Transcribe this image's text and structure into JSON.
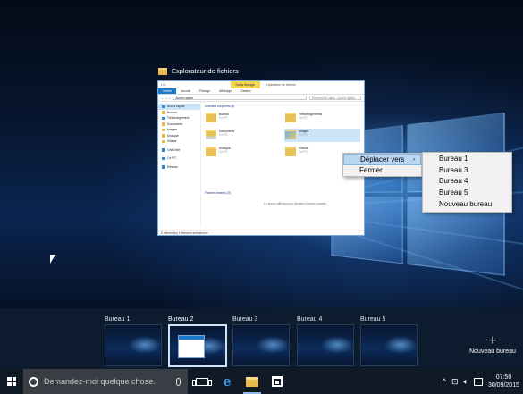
{
  "explorer": {
    "window_title": "Explorateur de fichiers",
    "context_tab": "Outils d'image",
    "title_text": "Explorateur de fichiers",
    "ribbon_tabs": [
      "Fichier",
      "Accueil",
      "Partage",
      "Affichage",
      "Gestion"
    ],
    "address": "Accès rapide",
    "search_placeholder": "Rechercher dans : Accès rapide",
    "nav_items": [
      "Accès rapide",
      "Bureau",
      "Téléchargement",
      "Documents",
      "Images",
      "Musique",
      "Vidéos",
      "OneDrive",
      "Ce PC",
      "Réseau"
    ],
    "frequent_header": "Dossiers fréquents (8)",
    "folders": [
      {
        "name": "Bureau",
        "sub": "Ce PC"
      },
      {
        "name": "Téléchargements",
        "sub": "Ce PC"
      },
      {
        "name": "Documents",
        "sub": "Ce PC"
      },
      {
        "name": "Images",
        "sub": "Ce PC"
      },
      {
        "name": "Musique",
        "sub": "Ce PC"
      },
      {
        "name": "Vidéos",
        "sub": "Ce PC"
      }
    ],
    "recent_header": "Fichiers récents (0)",
    "recent_note": "Le survol affichera les derniers fichiers ouverts",
    "status": "8 élément(s)   1 élément sélectionné"
  },
  "context_menu": {
    "items": [
      "Déplacer vers",
      "Fermer"
    ],
    "arrow": "›"
  },
  "submenu": {
    "items": [
      "Bureau 1",
      "Bureau 3",
      "Bureau 4",
      "Bureau 5",
      "Nouveau bureau"
    ]
  },
  "virtual_desktops": [
    {
      "name": "Bureau 1",
      "active": false
    },
    {
      "name": "Bureau 2",
      "active": true
    },
    {
      "name": "Bureau 3",
      "active": false
    },
    {
      "name": "Bureau 4",
      "active": false
    },
    {
      "name": "Bureau 5",
      "active": false
    }
  ],
  "new_desktop": {
    "icon": "+",
    "label": "Nouveau bureau"
  },
  "taskbar": {
    "search_placeholder": "Demandez-moi quelque chose.",
    "time": "07:50",
    "date": "30/09/2015",
    "tray_chevron": "^"
  }
}
